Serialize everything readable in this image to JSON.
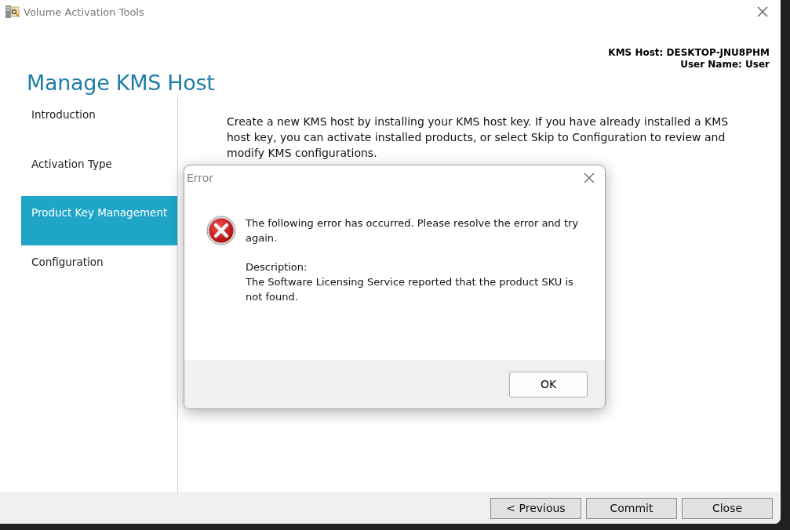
{
  "window": {
    "title": "Volume Activation Tools"
  },
  "page_title": "Manage KMS Host",
  "host_info": {
    "kms_host": "KMS Host: DESKTOP-JNU8PHM",
    "user_name": "User Name: User"
  },
  "sidebar": {
    "items": [
      {
        "label": "Introduction",
        "selected": false
      },
      {
        "label": "Activation Type",
        "selected": false
      },
      {
        "label": "Product Key Management",
        "selected": true
      },
      {
        "label": "Configuration",
        "selected": false
      }
    ]
  },
  "intro_text": "Create a new KMS host by installing your KMS host key. If you have already installed a KMS host key, you can activate installed products, or select Skip to Configuration to review and modify KMS configurations.",
  "buttons": [
    "< Previous",
    "Commit",
    "Close"
  ],
  "dialog": {
    "title": "Error",
    "message": "The following error has occurred. Please resolve the error and try again.",
    "description_label": "Description:",
    "description": "The Software Licensing Service reported that the product SKU is not found.",
    "buttons": [
      "OK"
    ]
  }
}
